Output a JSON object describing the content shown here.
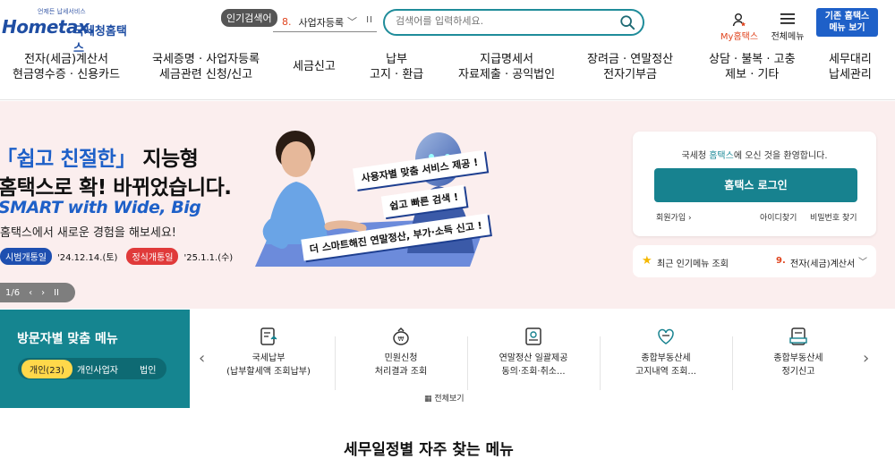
{
  "logo": {
    "tagline": "언제든 납세서비스",
    "brand": "Hometax.",
    "name": "국세청홈택스"
  },
  "popular_search": {
    "label": "인기검색어",
    "rank": "8.",
    "term": "사업자등록"
  },
  "search": {
    "placeholder": "검색어를 입력하세요."
  },
  "utils": {
    "my": "My홈택스",
    "all_menu": "전체메뉴",
    "legacy_line1": "기존 홈택스",
    "legacy_line2": "메뉴 보기"
  },
  "gnb": [
    {
      "l1": "전자(세금)계산서",
      "l2": "현금영수증 · 신용카드"
    },
    {
      "l1": "국세증명 · 사업자등록",
      "l2": "세금관련 신청/신고"
    },
    {
      "l1": "세금신고",
      "l2": ""
    },
    {
      "l1": "납부",
      "l2": "고지 · 환급"
    },
    {
      "l1": "지급명세서",
      "l2": "자료제출 · 공익법인"
    },
    {
      "l1": "장려금 · 연말정산",
      "l2": "전자기부금"
    },
    {
      "l1": "상담 · 불복 · 고충",
      "l2": "제보 · 기타"
    },
    {
      "l1": "세무대리",
      "l2": "납세관리"
    }
  ],
  "hero": {
    "line1_accent": "「쉽고 친절한」",
    "line1_rest": " 지능형",
    "line2": "홈택스로 확! 바뀌었습니다.",
    "english": "SMART with Wide, Big",
    "desc": "홈택스에서 새로운 경험을 해보세요!",
    "pilot_label": "시범개통일",
    "pilot_date": "'24.12.14.(토)",
    "official_label": "정식개통일",
    "official_date": "'25.1.1.(수)",
    "pager": "1/6",
    "bubbles": [
      "사용자별 맞춤 서비스 제공 !",
      "쉽고 빠른 검색 !",
      "더 스마트해진 연말정산, 부가·소득 신고 !"
    ]
  },
  "login": {
    "welcome_pre": "국세청 ",
    "welcome_hl": "홈택스",
    "welcome_post": "에 오신 것을 환영합니다.",
    "button": "홈택스 로그인",
    "join": "회원가입",
    "find_id": "아이디찾기",
    "find_pw": "비밀번호 찾기"
  },
  "popular_menu": {
    "label": "최근 인기메뉴 조회",
    "rank": "9.",
    "value": "전자(세금)계산서"
  },
  "visitor": {
    "title": "방문자별 맞춤 메뉴",
    "tabs": [
      "개인(23)",
      "개인사업자",
      "법인"
    ]
  },
  "services": [
    {
      "l1": "국세납부",
      "l2": "(납부할세액 조회납부)",
      "icon": "tax-payment-icon"
    },
    {
      "l1": "민원신청",
      "l2": "처리결과 조회",
      "icon": "civil-request-icon"
    },
    {
      "l1": "연말정산 일괄제공",
      "l2": "동의·조회·취소...",
      "icon": "year-end-icon"
    },
    {
      "l1": "종합부동산세",
      "l2": "고지내역 조회...",
      "icon": "property-tax-notice-icon"
    },
    {
      "l1": "종합부동산세",
      "l2": "정기신고",
      "icon": "property-tax-report-icon"
    }
  ],
  "view_all": "전체보기",
  "section_title": "세무일정별 자주 찾는 메뉴",
  "colors": {
    "brand": "#1f4ea3",
    "teal": "#17828f",
    "accent_red": "#e0451f",
    "hero_bg": "#fbeeee"
  }
}
